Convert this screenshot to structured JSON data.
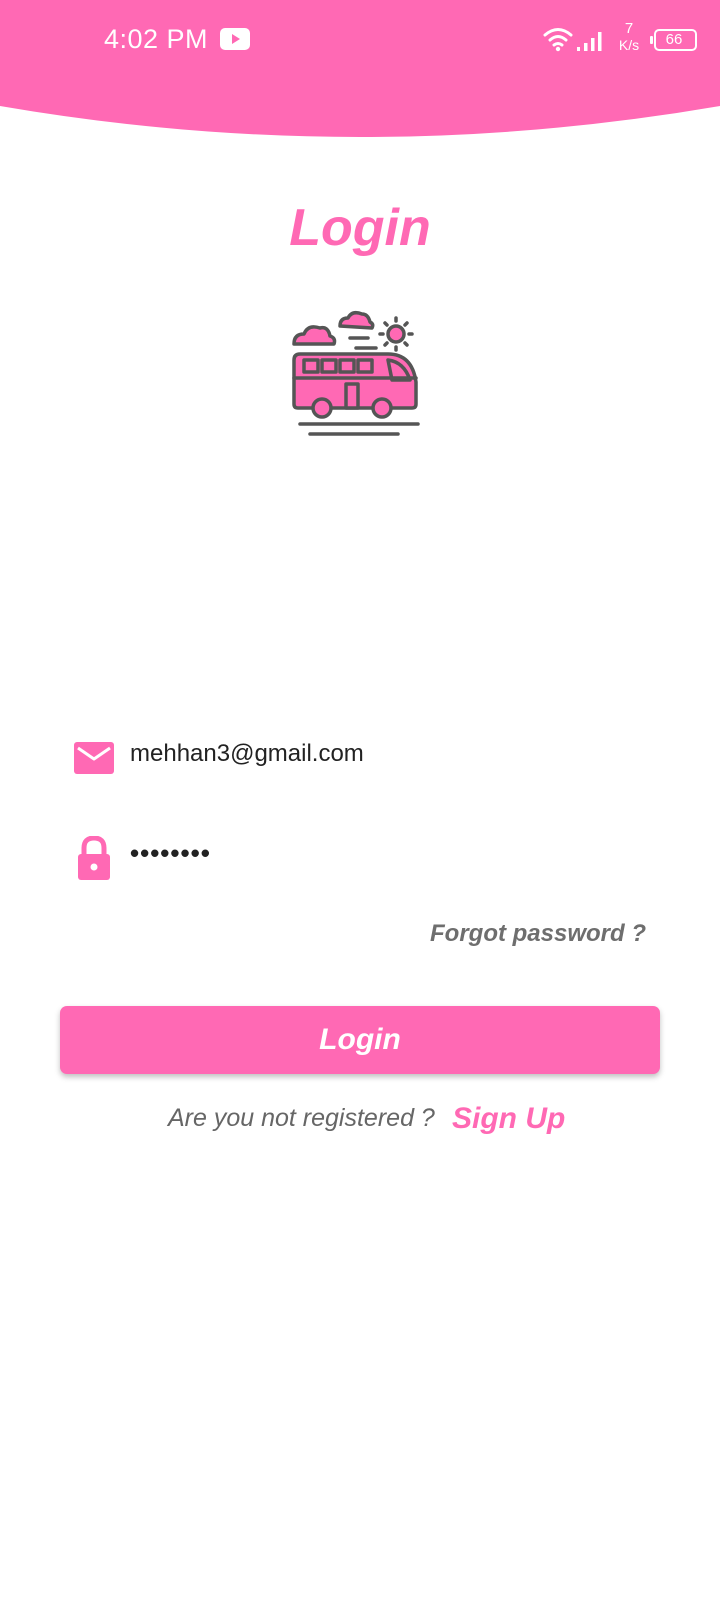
{
  "status_bar": {
    "time": "4:02 PM",
    "network_speed_value": "7",
    "network_speed_unit": "K/s",
    "battery_level": "66",
    "icons": [
      "youtube-icon",
      "wifi-icon",
      "signal-icon",
      "battery-icon"
    ]
  },
  "page": {
    "title": "Login",
    "illustration": "bus-icon"
  },
  "form": {
    "email_value": "mehhan3@gmail.com",
    "email_icon": "mail-icon",
    "password_value": "••••••••",
    "password_icon": "lock-icon",
    "forgot_password_label": "Forgot password ?",
    "login_button_label": "Login"
  },
  "footer": {
    "register_prompt": "Are you not registered ?",
    "signup_label": "Sign Up"
  },
  "colors": {
    "accent": "#ff69b4",
    "icon_stroke": "#555555",
    "muted_text": "#6e6e6e"
  }
}
